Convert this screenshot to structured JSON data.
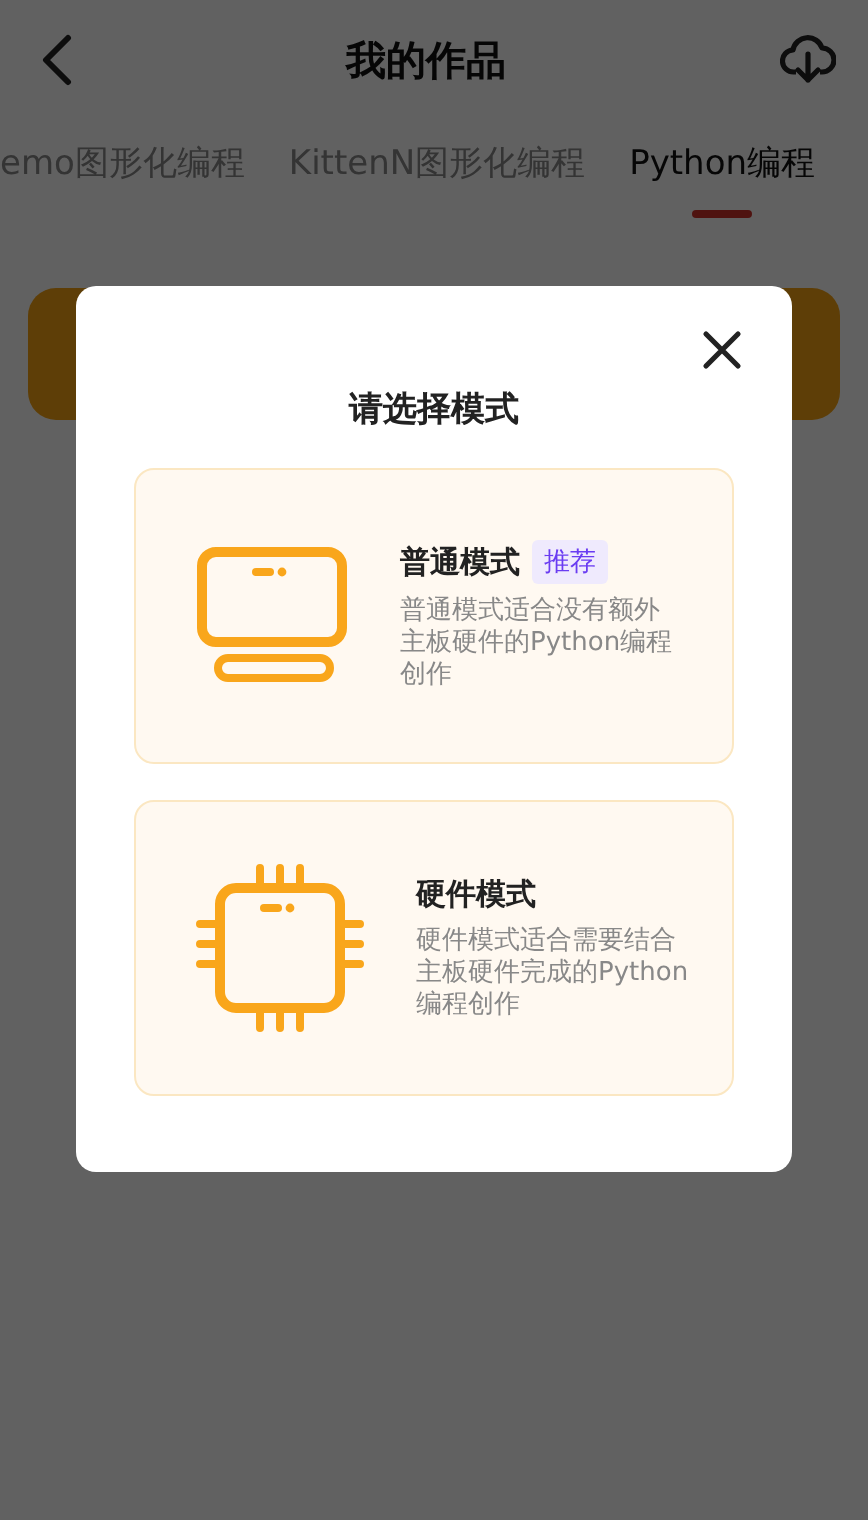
{
  "header": {
    "title": "我的作品"
  },
  "tabs": [
    {
      "label": "emo图形化编程",
      "selected": false
    },
    {
      "label": "KittenN图形化编程",
      "selected": false
    },
    {
      "label": "Python编程",
      "selected": true
    }
  ],
  "dialog": {
    "title": "请选择模式",
    "modes": [
      {
        "kind": "monitor",
        "name": "普通模式",
        "badge": "推荐",
        "description": "普通模式适合没有额外主板硬件的Python编程创作"
      },
      {
        "kind": "chip",
        "name": "硬件模式",
        "description": "硬件模式适合需要结合主板硬件完成的Python编程创作"
      }
    ]
  }
}
